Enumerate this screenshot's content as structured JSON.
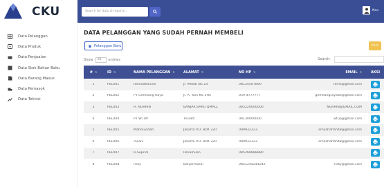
{
  "brand": {
    "name": "CKU"
  },
  "topbar": {
    "search_placeholder": "Search for data & reports...",
    "user_name": "Neo"
  },
  "sidebar": {
    "items": [
      {
        "label": "Data Pelanggan",
        "icon": "table-icon"
      },
      {
        "label": "Data Produk",
        "icon": "box-icon"
      },
      {
        "label": "Data Penjualan",
        "icon": "cash-icon"
      },
      {
        "label": "Data Stok Bahan Baku",
        "icon": "layers-icon"
      },
      {
        "label": "Data Barang Masuk",
        "icon": "inbox-icon"
      },
      {
        "label": "Data Pemasok",
        "icon": "truck-icon"
      },
      {
        "label": "Data Teknisi",
        "icon": "chart-icon"
      }
    ]
  },
  "main": {
    "title": "DATA PELANGGAN YANG SUDAH PERNAH MEMBELI",
    "new_button": "Pelanggan Baru",
    "print_button": "Print",
    "show_label": "Show",
    "show_value": "10",
    "entries_label": "entries",
    "search_label": "Search:",
    "columns": [
      "#",
      "ID",
      "NAMA PELANGGAN",
      "ALAMAT",
      "NO HP",
      "EMAIL",
      "AKSI"
    ],
    "rows": [
      {
        "no": "1",
        "id": "PEL001",
        "nama": "Ramadhanoor",
        "alamat": "Jl. Melati No 24",
        "hp": "08124567890",
        "email": "rama@gmail.com"
      },
      {
        "no": "2",
        "id": "PEL002",
        "nama": "PT Gemilang Raya",
        "alamat": "Jl. A. Yani No 5HS",
        "hp": "059-4777777",
        "email": "gemilangraya83@gmail.com"
      },
      {
        "no": "3",
        "id": "PEL003",
        "nama": "H. NURHIN",
        "alamat": "BANJAR BARU QMALL",
        "hp": "085220000000",
        "email": "NURHIN@GMAIL.COM"
      },
      {
        "no": "4",
        "id": "PEL004",
        "nama": "PT WTUP",
        "alamat": "Trisakti",
        "hp": "08130000000",
        "email": "wtup@gmail.com"
      },
      {
        "no": "5",
        "id": "PEL005",
        "nama": "Mahmuddah",
        "alamat": "Jakarta P.O. BOX 320",
        "hp": "089932323",
        "email": "emailhaflah48@gmail.com"
      },
      {
        "no": "6",
        "id": "PEL006",
        "nama": "rasani",
        "alamat": "Jakarta P.O. BOX 320",
        "hp": "089932323",
        "email": "emailhaflah48@gmail.com"
      },
      {
        "no": "7",
        "id": "PEL007",
        "nama": "H.Supridi",
        "alamat": "Penamuan",
        "hp": "085268888880",
        "email": ""
      },
      {
        "no": "8",
        "id": "PEL008",
        "nama": "risky",
        "alamat": "banjarmasin",
        "hp": "0851244244242",
        "email": "risky@gmail.com"
      }
    ]
  },
  "colors": {
    "navbar": "#3a4e96",
    "table_header": "#3e4f93",
    "print_action": "#1e9fd9",
    "print_button": "#f0c24f"
  }
}
